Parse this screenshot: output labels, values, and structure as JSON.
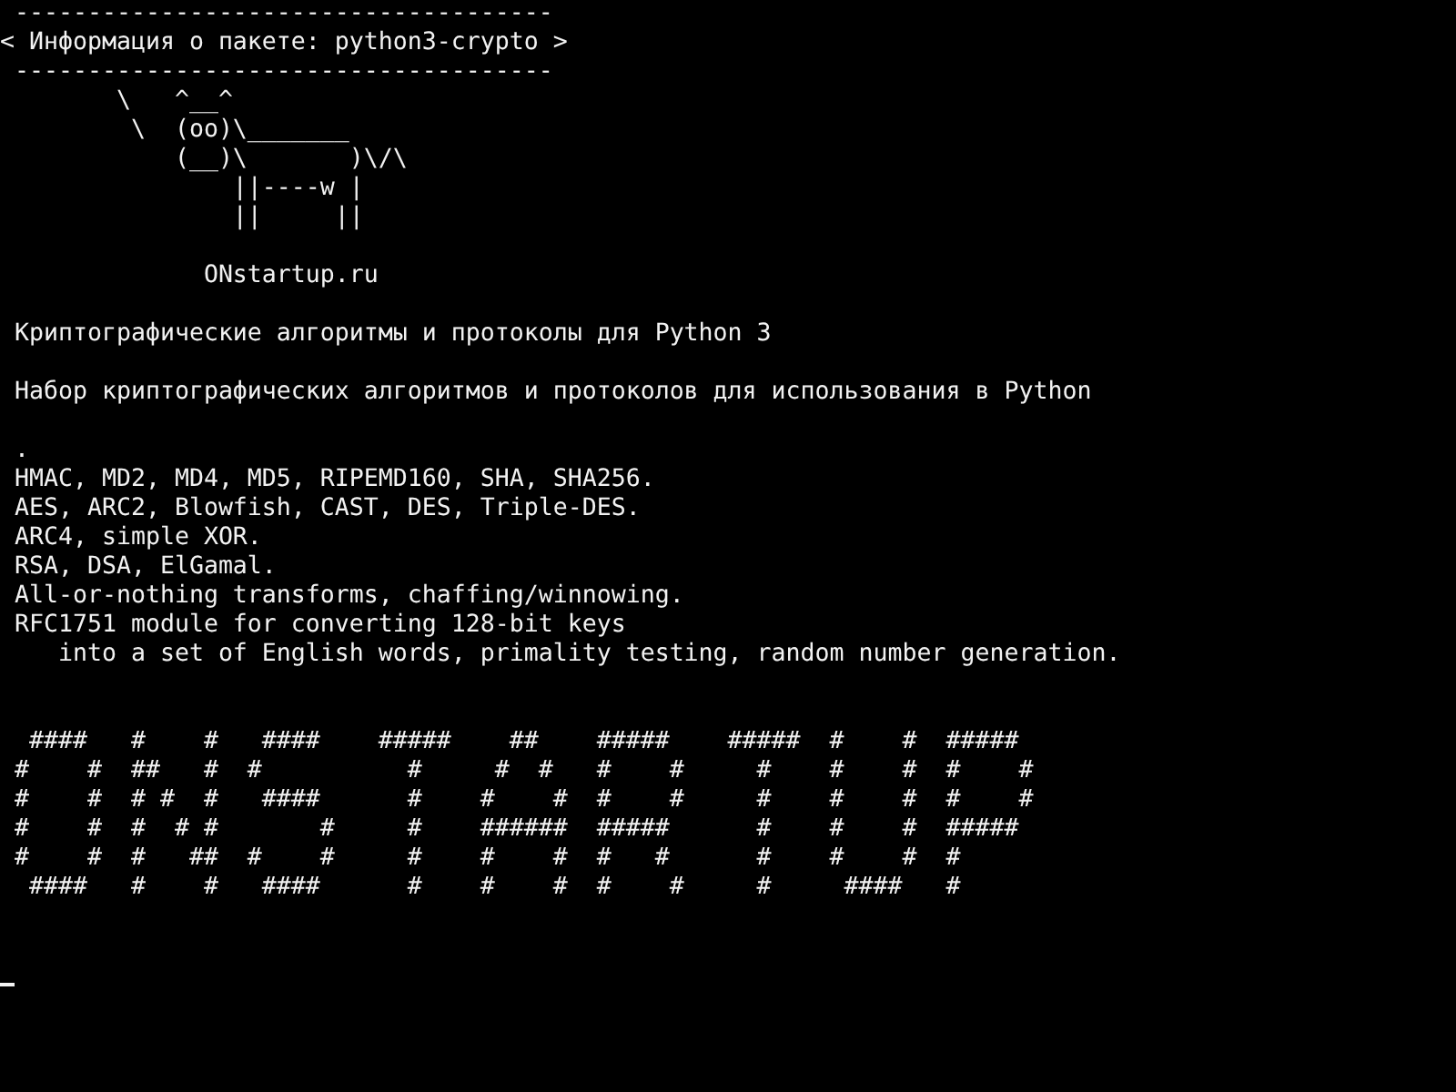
{
  "header": {
    "top_rule": " -------------------------------------",
    "title": "< Информация о пакете: python3-crypto >",
    "bottom_rule": " -------------------------------------"
  },
  "cow_art": [
    "        \\   ^__^",
    "         \\  (oo)\\_______",
    "            (__)\\       )\\/\\",
    "                ||----w |",
    "                ||     ||"
  ],
  "site": "              ONstartup.ru",
  "summary": " Криптографические алгоритмы и протоколы для Python 3",
  "description": " Набор криптографических алгоритмов и протоколов для использования в Python",
  "details": [
    " .",
    " HMAC, MD2, MD4, MD5, RIPEMD160, SHA, SHA256.",
    " AES, ARC2, Blowfish, CAST, DES, Triple-DES.",
    " ARC4, simple XOR.",
    " RSA, DSA, ElGamal.",
    " All-or-nothing transforms, chaffing/winnowing.",
    " RFC1751 module for converting 128-bit keys",
    "    into a set of English words, primality testing, random number generation."
  ],
  "banner": [
    "  ####   #    #   ####    #####    ##    #####    #####  #    #  #####",
    " #    #  ##   #  #          #     #  #   #    #     #    #    #  #    #",
    " #    #  # #  #   ####      #    #    #  #    #     #    #    #  #    #",
    " #    #  #  # #       #     #    ######  #####      #    #    #  #####",
    " #    #  #   ##  #    #     #    #    #  #   #      #    #    #  #",
    "  ####   #    #   ####      #    #    #  #    #     #     ####   #"
  ]
}
